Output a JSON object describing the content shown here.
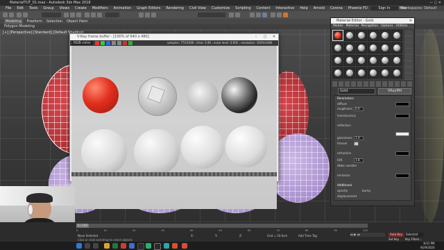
{
  "app": {
    "title": "MaterialTUT_01.max - Autodesk 3ds Max 2018",
    "menu": [
      "File",
      "Edit",
      "Tools",
      "Group",
      "Views",
      "Create",
      "Modifiers",
      "Animation",
      "Graph Editors",
      "Rendering",
      "Civil View",
      "Customize",
      "Scripting",
      "Content",
      "Interactive",
      "Help",
      "Arnold",
      "Corona",
      "Phoenix FD",
      "RealFlow | 3ds Max"
    ],
    "ribbon": [
      "Modeling",
      "Freeform",
      "Selection",
      "Object Paint"
    ],
    "ribbon_sub": "Polygon Modeling",
    "sign_in": "Sign In",
    "workspace": "Workspaces: Default",
    "viewport_label": "[+] [Perspective] [Standard] [Default Shading]"
  },
  "frame_buffer": {
    "title": "V-Ray frame buffer - [100% of 640 x 480]",
    "toolbar_left": "RGB color",
    "stats": "samples: 772/1000 ; time: 3:49 ; noise level: 0.002 ; resolution: 1920x1080"
  },
  "material_editor": {
    "title": "Material Editor - Gold",
    "menu": [
      "Modes",
      "Material",
      "Navigation",
      "Options",
      "Utilities"
    ],
    "material_name": "Gold",
    "material_type": "VRayMtl",
    "rollouts": {
      "parameters": "Parameters",
      "diffuse": "diffuse",
      "roughness_label": "roughness",
      "roughness_val": "0.0",
      "translucency": "translucency",
      "reflection": "reflection",
      "glossiness_label": "glossiness",
      "glossiness_val": "1.0",
      "fresnel_label": "fresnel",
      "refraction": "refraction",
      "ior_label": "IOR",
      "ior_val": "1.6",
      "abbe_label": "Abbe number",
      "emission": "emission",
      "additional": "Additional",
      "opacity": "opacity",
      "bump": "bump",
      "displacement": "displacement"
    }
  },
  "timeline": {
    "frame": "0 / 100",
    "ticks": [
      "0",
      "10",
      "20",
      "30",
      "40",
      "50",
      "60",
      "70",
      "80",
      "90",
      "100"
    ]
  },
  "status": {
    "selected": "None Selected",
    "hint": "Click or click-and-drag to select objects",
    "add_time_tag": "Add Time Tag",
    "auto_key": "Auto Key",
    "set_key": "Set Key",
    "selected_mode": "Selected",
    "key_filters": "Key Filters...",
    "x": "X:",
    "y": "Y:",
    "z": "Z:",
    "grid": "Grid = 10.0cm"
  },
  "taskbar": {
    "clock_time": "8:01 PM",
    "clock_date": "9/29/2020"
  },
  "colors": {
    "red_ball": "#e2301f",
    "wire_red": "#c8353b",
    "wire_purple": "#b89ed6",
    "viewport_bg": "#3f3f3f"
  }
}
